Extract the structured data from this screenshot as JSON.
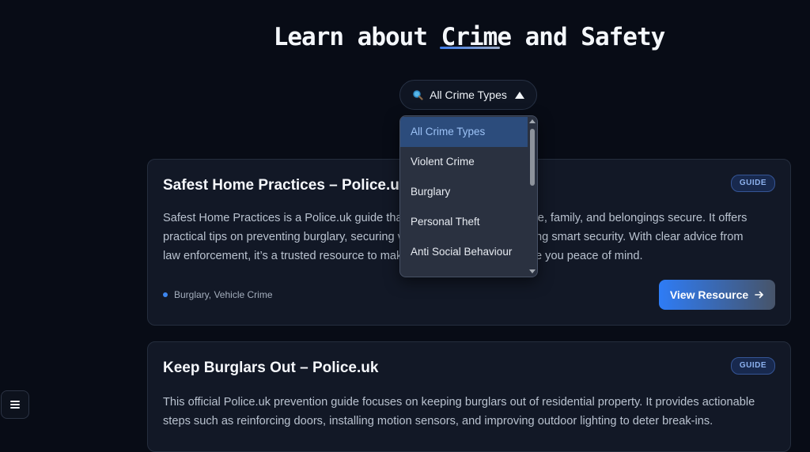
{
  "page": {
    "title": "Learn about Crime and Safety"
  },
  "filter": {
    "label": "All Crime Types",
    "icon": "search-icon",
    "expanded_icon": "caret-up-icon",
    "options": [
      "All Crime Types",
      "Violent Crime",
      "Burglary",
      "Personal Theft",
      "Anti Social Behaviour"
    ],
    "selected": "All Crime Types"
  },
  "resources": [
    {
      "title": "Safest Home Practices – Police.uk",
      "badge": "GUIDE",
      "description_lines": [
        "Safest Home Practices is a Police.uk guide that helps you keep your home, family, and belongings secure. It offers",
        "practical tips on preventing burglary, securing vehicles and bikes, and using smart security. With clear advice from",
        "law enforcement, it’s a trusted resource to make your home safer and give you peace of mind."
      ],
      "tags": "Burglary, Vehicle Crime",
      "button_label": "View Resource"
    },
    {
      "title": "Keep Burglars Out – Police.uk",
      "badge": "GUIDE",
      "description_lines": [
        "This official Police.uk prevention guide focuses on keeping burglars out of residential property. It provides actionable",
        "steps such as reinforcing doors, installing motion sensors, and improving outdoor lighting to deter break-ins."
      ]
    }
  ],
  "colors": {
    "background": "#080c16",
    "accent": "#2e7cf6",
    "card": "#121826"
  }
}
